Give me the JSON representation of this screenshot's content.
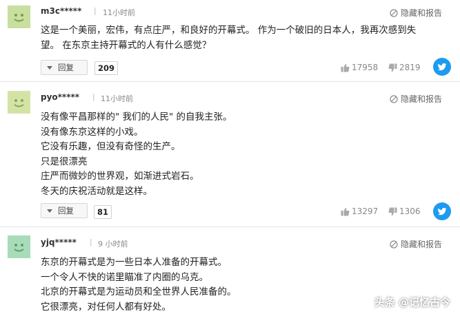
{
  "comments": [
    {
      "username": "m3c*****",
      "separator": "|",
      "time": "11小时前",
      "report": "隐藏和报告",
      "body": "这是一个美丽，宏伟，有点庄严，和良好的开幕式。 作为一个破旧的日本人，我再次感到失\n望。 在东京主持开幕式的人有什么感觉？",
      "reply_label": "回复",
      "reply_count": "209",
      "likes": "17958",
      "dislikes": "2819",
      "avatar_color": "#c8df9f"
    },
    {
      "username": "pyo*****",
      "separator": "|",
      "time": "11小时前",
      "report": "隐藏和报告",
      "body": "没有像平昌那样的\" 我们的人民\" 的自我主张。\n没有像东京这样的小戏。\n它没有乐趣，但没有奇怪的生产。\n只是很漂亮\n庄严而微妙的世界观，如渐进式岩石。\n冬天的庆祝活动就是这样。",
      "reply_label": "回复",
      "reply_count": "81",
      "likes": "13297",
      "dislikes": "1306",
      "avatar_color": "#d3e3a6"
    },
    {
      "username": "yjq*****",
      "separator": "|",
      "time": "9 小时前",
      "report": "隐藏和报告",
      "body": "东京的开幕式是为一些日本人准备的开幕式。\n一个令人不快的诺里瞄准了内圈的乌克。\n北京的开幕式是为运动员和全世界人民准备的。\n它很漂亮，对任何人都有好处。",
      "avatar_color": "#a8dcb8"
    }
  ],
  "watermark": "头条 @记忆古今",
  "colors": {
    "twitter": "#1d9bf0",
    "divider": "#e4e4e4"
  }
}
